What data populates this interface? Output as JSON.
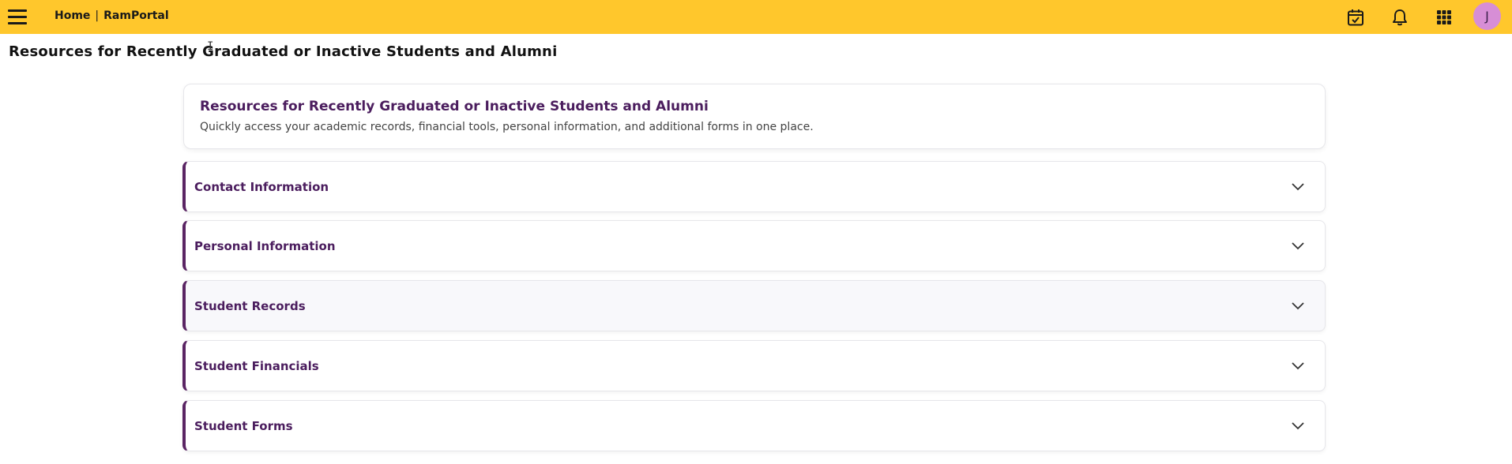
{
  "topbar": {
    "breadcrumb_home": "Home",
    "breadcrumb_sep": "|",
    "breadcrumb_portal": "RamPortal",
    "avatar_initial": "J",
    "background": "#ffc72c",
    "icons": [
      "menu-icon",
      "calendar-check-icon",
      "bell-icon",
      "apps-grid-icon"
    ]
  },
  "page": {
    "title": "Resources for Recently Graduated or Inactive Students and Alumni"
  },
  "intro": {
    "title": "Resources for Recently Graduated or Inactive Students and Alumni",
    "description": "Quickly access your academic records, financial tools, personal information, and additional forms in one place."
  },
  "sections": [
    {
      "label": "Contact Information"
    },
    {
      "label": "Personal Information"
    },
    {
      "label": "Student Records"
    },
    {
      "label": "Student Financials"
    },
    {
      "label": "Student Forms"
    }
  ],
  "colors": {
    "accent": "#5a2463",
    "heading": "#4b1d5e",
    "avatar": "#d78ed6"
  }
}
